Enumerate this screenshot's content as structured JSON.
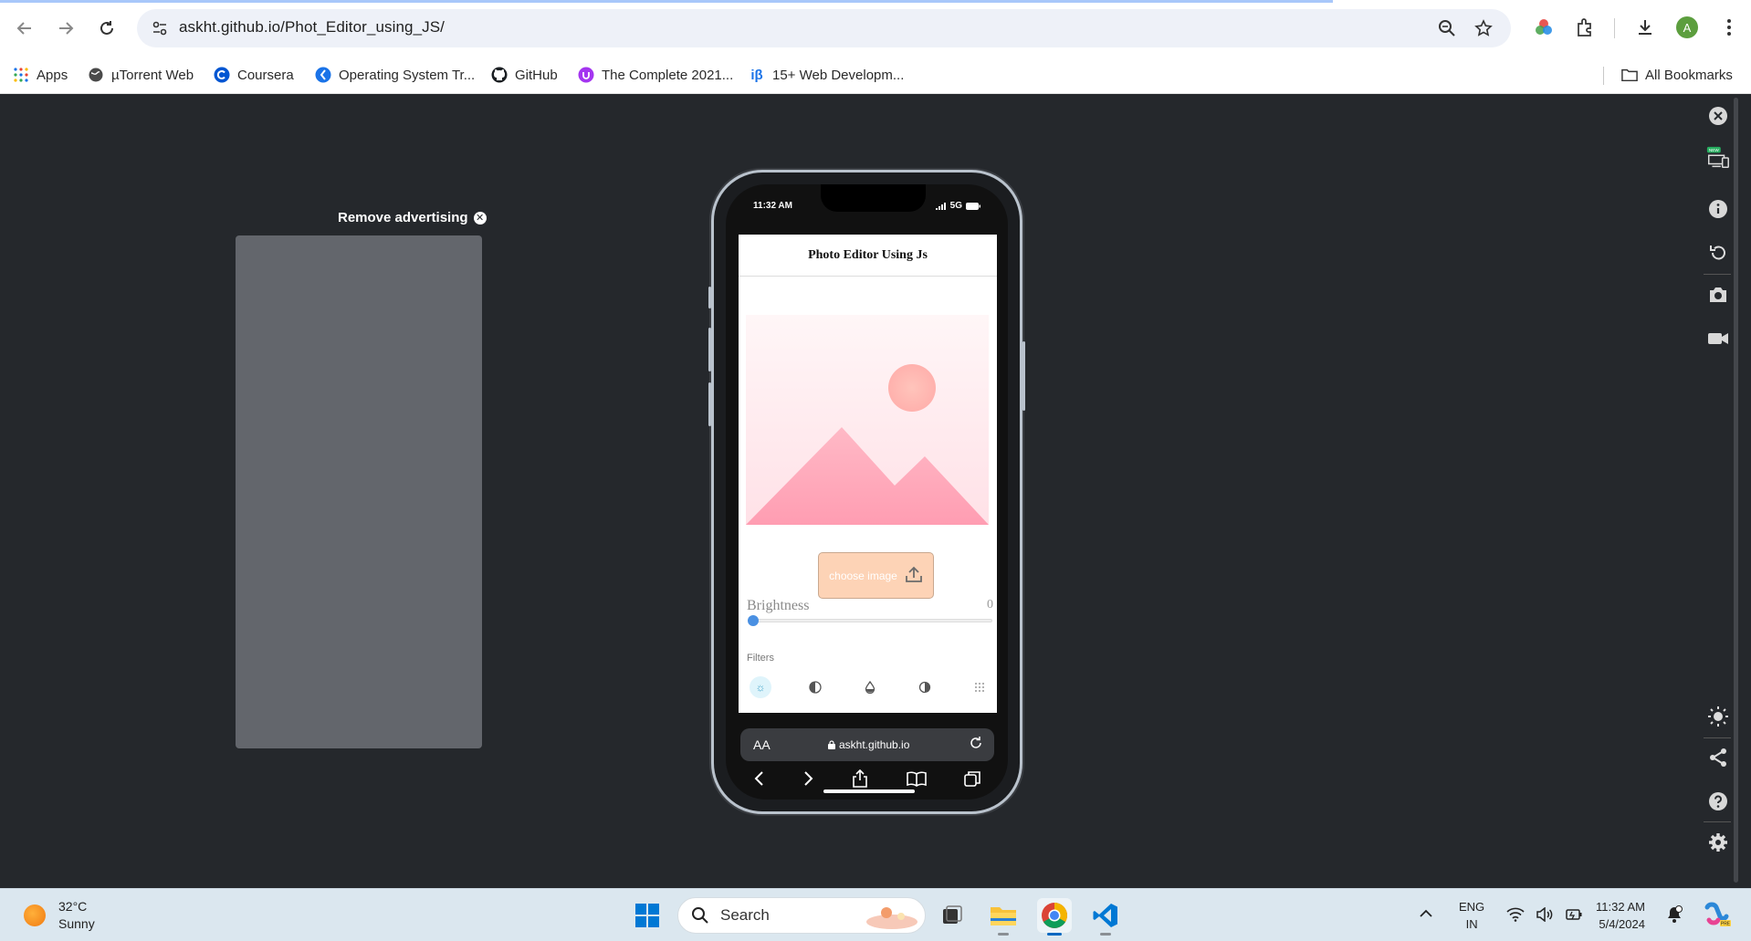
{
  "browser": {
    "url": "askht.github.io/Phot_Editor_using_JS/",
    "profile_initial": "A",
    "bookmarks": [
      {
        "label": "Apps",
        "icon": "apps-grid-icon"
      },
      {
        "label": "µTorrent Web",
        "icon": "utorrent-icon"
      },
      {
        "label": "Coursera",
        "icon": "coursera-icon"
      },
      {
        "label": "Operating System Tr...",
        "icon": "site-icon"
      },
      {
        "label": "GitHub",
        "icon": "github-icon"
      },
      {
        "label": "The Complete 2021...",
        "icon": "udemy-icon"
      },
      {
        "label": "15+ Web Developm...",
        "icon": "site-icon"
      }
    ],
    "all_bookmarks": "All Bookmarks"
  },
  "page": {
    "ad_remove": "Remove advertising",
    "ad_close": "✕"
  },
  "phone": {
    "status_time": "11:32 AM",
    "status_network": "5G",
    "app_title": "Photo Editor Using Js",
    "choose_image": "choose image",
    "brightness_label": "Brightness",
    "brightness_value": "0",
    "brightness_level": 0,
    "filters_label": "Filters",
    "filters": [
      "brightness",
      "contrast",
      "saturate",
      "invert",
      "blur"
    ],
    "safari_aa": "AA",
    "safari_host": "askht.github.io"
  },
  "taskbar": {
    "temp": "32°C",
    "condition": "Sunny",
    "search": "Search",
    "lang1": "ENG",
    "lang2": "IN",
    "time": "11:32 AM",
    "date": "5/4/2024"
  },
  "colors": {
    "page_bg": "#25282c",
    "button_peach": "#fdd3b6",
    "slider_blue": "#4a90e2",
    "taskbar_bg": "#dbe7ef"
  }
}
